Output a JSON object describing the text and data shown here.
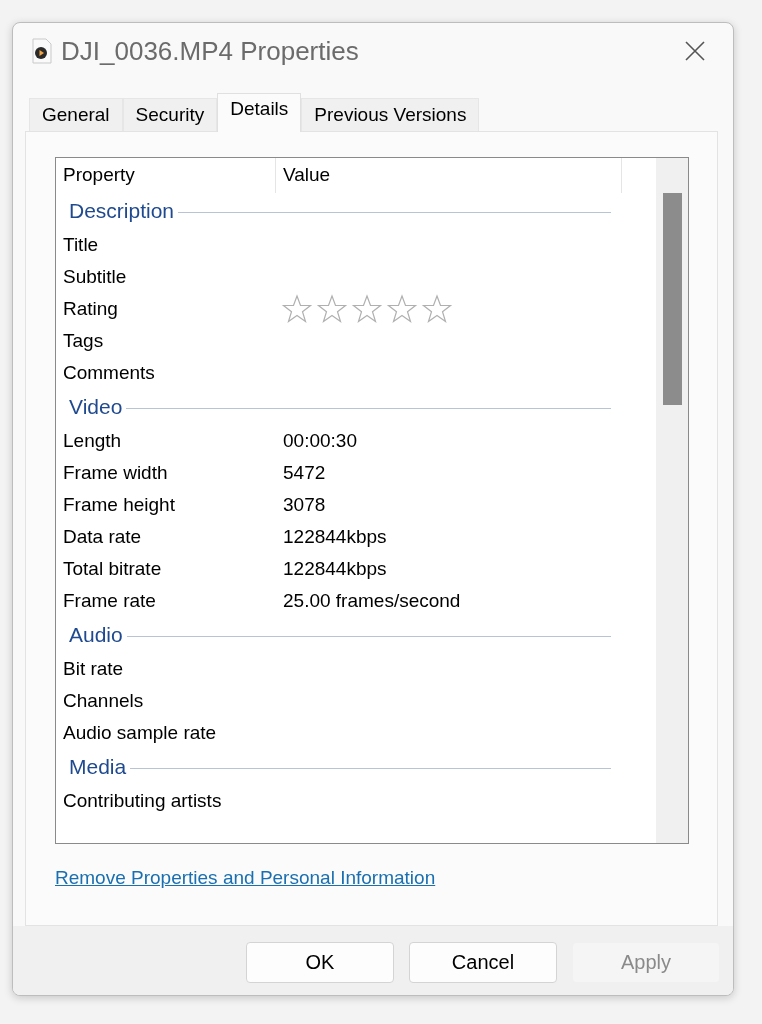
{
  "window": {
    "title": "DJI_0036.MP4 Properties"
  },
  "tabs": [
    {
      "label": "General",
      "selected": false
    },
    {
      "label": "Security",
      "selected": false
    },
    {
      "label": "Details",
      "selected": true
    },
    {
      "label": "Previous Versions",
      "selected": false
    }
  ],
  "columns": [
    "Property",
    "Value"
  ],
  "groups": [
    {
      "heading": "Description",
      "rows": [
        {
          "kind": "text",
          "property": "Title"
        },
        {
          "kind": "text",
          "property": "Subtitle"
        },
        {
          "kind": "rating",
          "property": "Rating",
          "stars": 0
        },
        {
          "kind": "text",
          "property": "Tags"
        },
        {
          "kind": "text",
          "property": "Comments"
        }
      ]
    },
    {
      "heading": "Video",
      "rows": [
        {
          "kind": "text",
          "property": "Length",
          "value": "00:00:30"
        },
        {
          "kind": "text",
          "property": "Frame width",
          "value": "5472"
        },
        {
          "kind": "text",
          "property": "Frame height",
          "value": "3078"
        },
        {
          "kind": "text",
          "property": "Data rate",
          "value": "122844kbps"
        },
        {
          "kind": "text",
          "property": "Total bitrate",
          "value": "122844kbps"
        },
        {
          "kind": "text",
          "property": "Frame rate",
          "value": "25.00 frames/second"
        }
      ]
    },
    {
      "heading": "Audio",
      "rows": [
        {
          "kind": "text",
          "property": "Bit rate"
        },
        {
          "kind": "text",
          "property": "Channels"
        },
        {
          "kind": "text",
          "property": "Audio sample rate"
        }
      ]
    },
    {
      "heading": "Media",
      "rows": [
        {
          "kind": "text",
          "property": "Contributing artists"
        }
      ]
    }
  ],
  "link": "Remove Properties and Personal Information",
  "buttons": [
    {
      "label": "OK",
      "disabled": false
    },
    {
      "label": "Cancel",
      "disabled": false
    },
    {
      "label": "Apply",
      "disabled": true
    }
  ]
}
